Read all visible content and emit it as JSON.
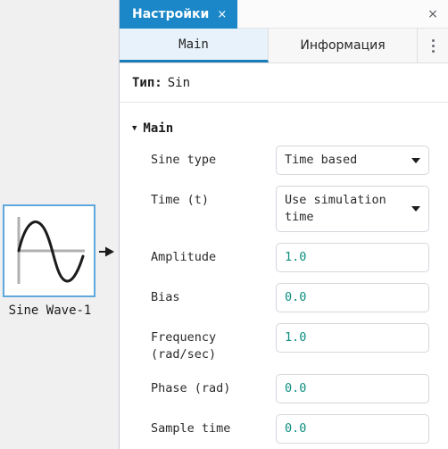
{
  "canvas": {
    "block": {
      "name": "Sine Wave-1",
      "icon": "sine-wave-icon",
      "selected_color": "#5fa8dc",
      "port": "output-port-arrow"
    }
  },
  "panel": {
    "titlebar": {
      "tab_label": "Настройки",
      "tab_close": "×",
      "window_close": "×"
    },
    "tabs": [
      {
        "label": "Main",
        "active": true
      },
      {
        "label": "Информация",
        "active": false
      }
    ],
    "more_menu": "⋮",
    "type_row": {
      "key": "Тип:",
      "value": "Sin"
    },
    "section": {
      "caret": "▼",
      "title": "Main"
    },
    "fields": [
      {
        "label": "Sine type",
        "type": "select",
        "value": "Time based"
      },
      {
        "label": "Time (t)",
        "type": "select",
        "value": "Use simulation time"
      },
      {
        "label": "Amplitude",
        "type": "input",
        "value": "1.0"
      },
      {
        "label": "Bias",
        "type": "input",
        "value": "0.0"
      },
      {
        "label": "Frequency (rad/sec)",
        "type": "input",
        "value": "1.0"
      },
      {
        "label": "Phase (rad)",
        "type": "input",
        "value": "0.0"
      },
      {
        "label": "Sample time",
        "type": "input",
        "value": "0.0"
      }
    ]
  },
  "colors": {
    "accent_blue": "#1b87c9",
    "tab_active_bg": "#e7f2fb",
    "tab_underline": "#1b7cba",
    "value_text": "#0e8f80",
    "canvas_bg": "#f0f0f0"
  }
}
